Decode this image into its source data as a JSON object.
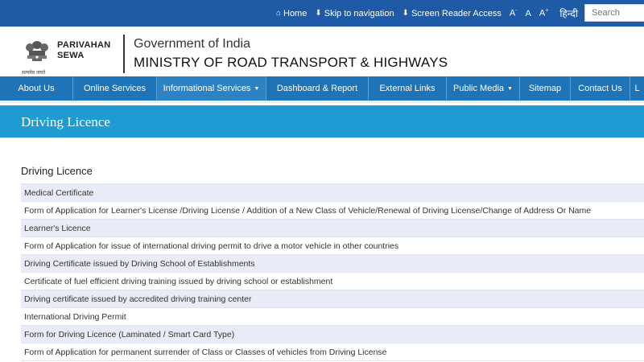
{
  "topbar": {
    "home": "Home",
    "skip": "Skip to navigation",
    "screen_reader": "Screen Reader Access",
    "font_small": "A",
    "font_small_sup": "-",
    "font_normal": "A",
    "font_large": "A",
    "font_large_sup": "+",
    "hindi": "हिन्दी",
    "search_placeholder": "Search"
  },
  "header": {
    "brand_line1": "PARIVAHAN",
    "brand_line2": "SEWA",
    "emblem_caption": "सत्यमेव जयते",
    "gov": "Government of India",
    "ministry": "MINISTRY OF ROAD TRANSPORT & HIGHWAYS"
  },
  "nav": [
    {
      "label": "About Us",
      "caret": ""
    },
    {
      "label": "Online Services",
      "caret": ""
    },
    {
      "label": "Informational Services",
      "caret": "▼"
    },
    {
      "label": "Dashboard & Report",
      "caret": ""
    },
    {
      "label": "External Links",
      "caret": ""
    },
    {
      "label": "Public Media",
      "caret": "▼"
    },
    {
      "label": "Sitemap",
      "caret": ""
    },
    {
      "label": "Contact Us",
      "caret": ""
    },
    {
      "label": "L",
      "caret": ""
    }
  ],
  "page_title": "Driving Licence",
  "section_heading": "Driving Licence",
  "items": [
    "Medical Certificate",
    "Form of Application for Learner's License /Driving License / Addition of a New Class of Vehicle/Renewal of Driving License/Change of Address Or Name",
    "Learner's Licence",
    "Form of Application for issue of international driving permit to drive a motor vehicle in other countries",
    "Driving Certificate issued by Driving School of Establishments",
    "Certificate of fuel efficient driving training issued by driving school or establishment",
    "Driving certificate issued by accredited driving training center",
    "International Driving Permit",
    "Form for Driving Licence (Laminated / Smart Card Type)",
    "Form of Application for permanent surrender of Class or Classes of vehicles from Driving License"
  ],
  "colors": {
    "topbar": "#1f5aa6",
    "nav": "#1f73b7",
    "title_band": "#1f9bd4",
    "row_alt": "#e9ecf7"
  }
}
